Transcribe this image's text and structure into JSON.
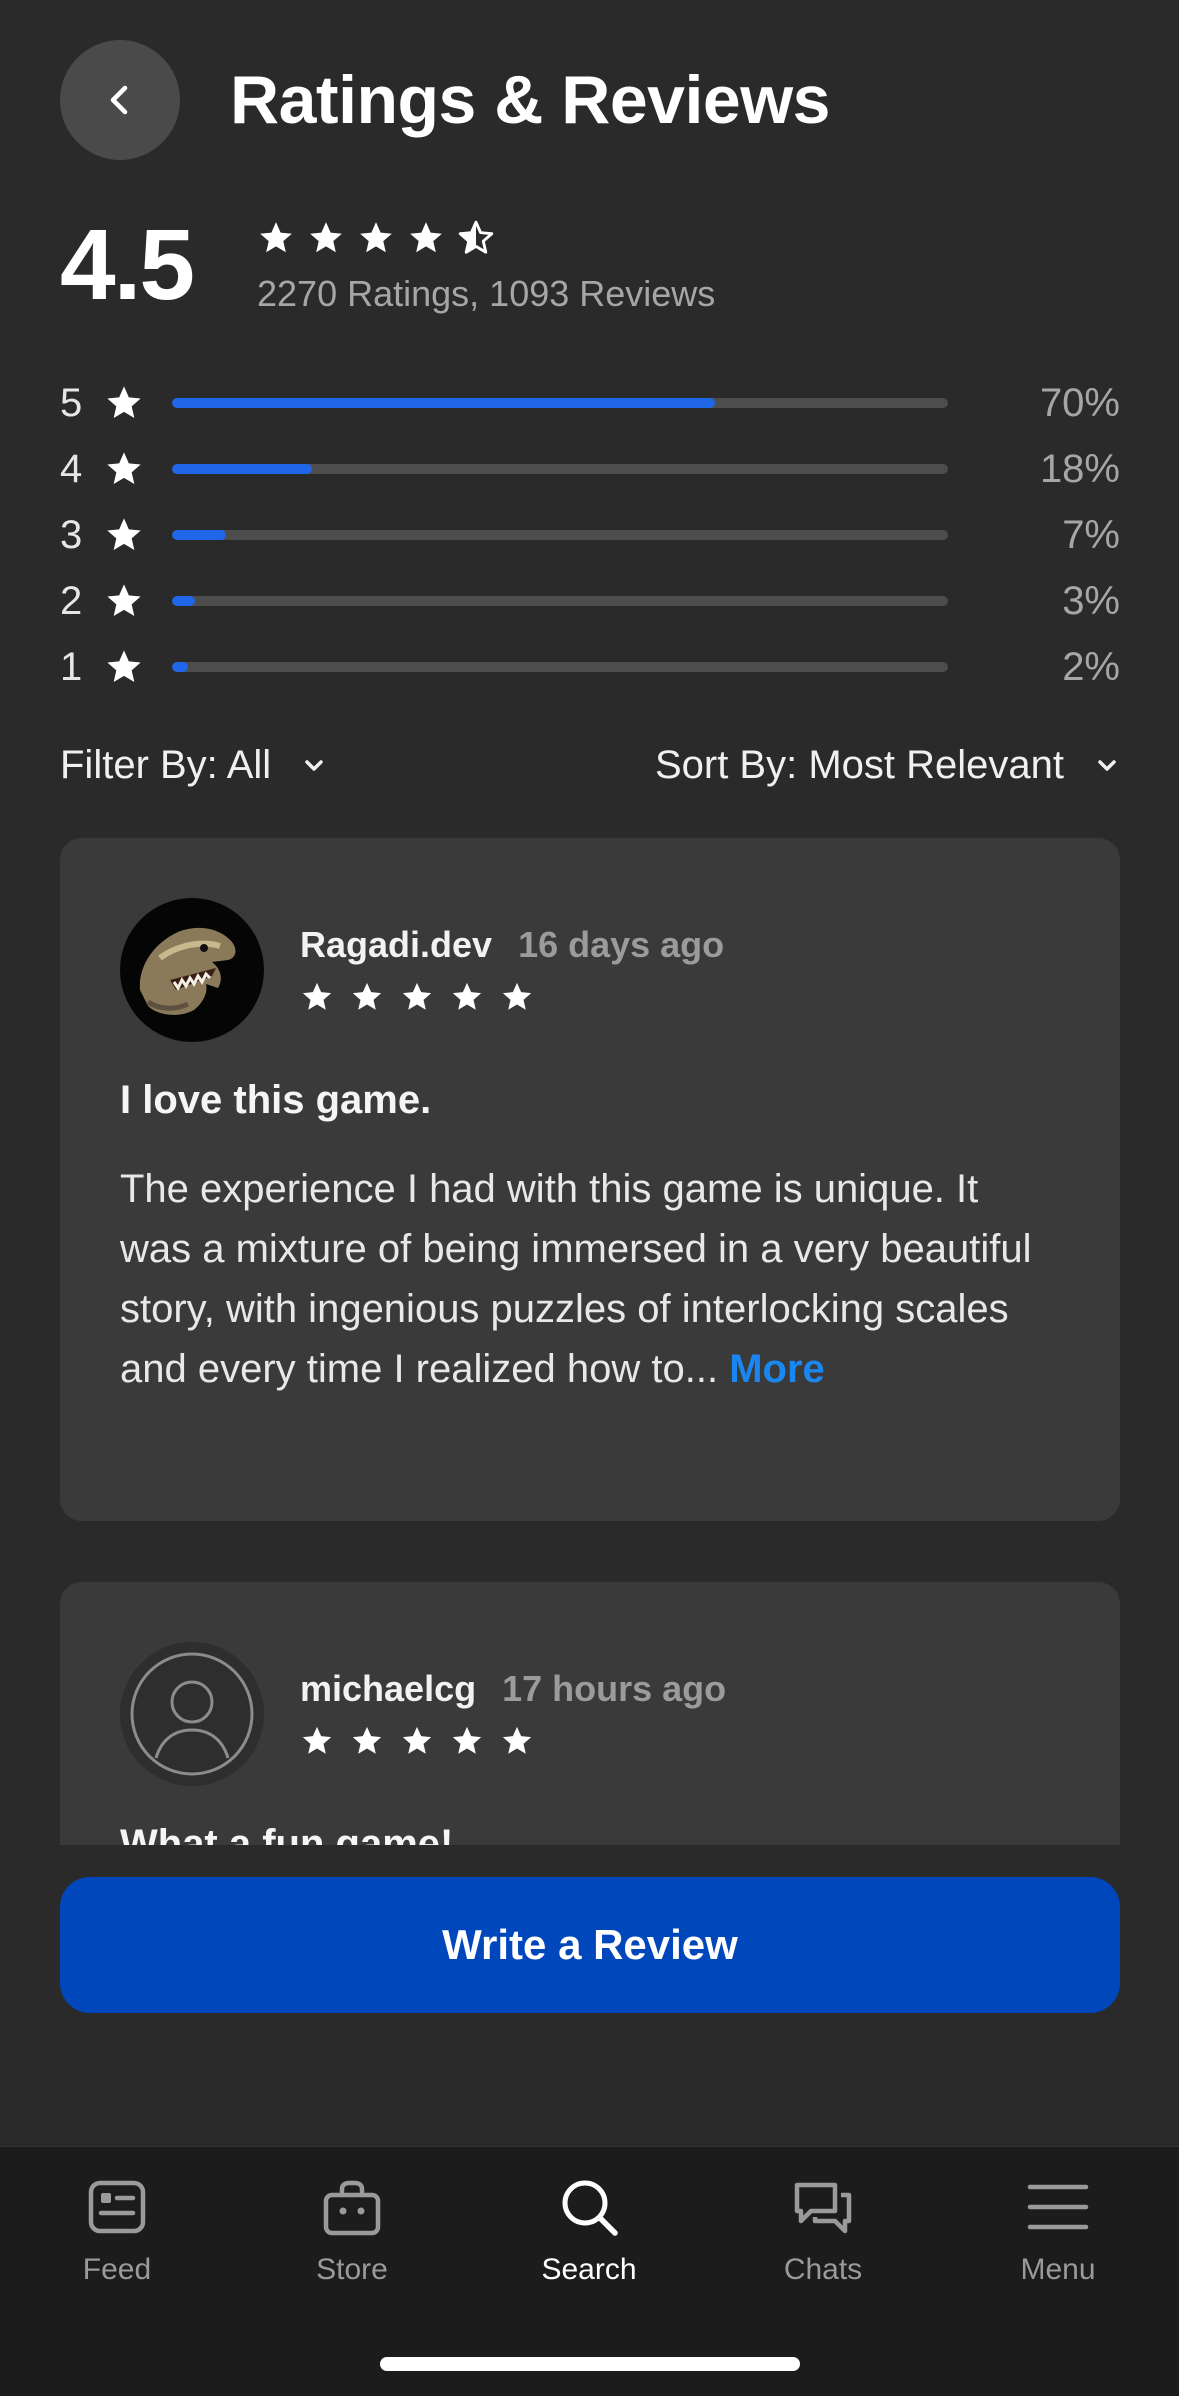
{
  "header": {
    "title": "Ratings & Reviews"
  },
  "summary": {
    "rating": "4.5",
    "rating_value": 4.5,
    "counts": "2270 Ratings, 1093 Reviews"
  },
  "histogram": [
    {
      "stars": "5",
      "percent": "70%",
      "fraction": 0.7
    },
    {
      "stars": "4",
      "percent": "18%",
      "fraction": 0.18
    },
    {
      "stars": "3",
      "percent": "7%",
      "fraction": 0.07
    },
    {
      "stars": "2",
      "percent": "3%",
      "fraction": 0.03
    },
    {
      "stars": "1",
      "percent": "2%",
      "fraction": 0.02
    }
  ],
  "filters": {
    "filter_label": "Filter By: All",
    "sort_label": "Sort By: Most Relevant"
  },
  "reviews": [
    {
      "author": "Ragadi.dev",
      "time": "16 days ago",
      "stars": 5,
      "title": "I love this game.",
      "body": "The experience I had with this game is unique. It was a mixture of being immersed in a very beautiful story, with ingenious puzzles of interlocking scales and every time I realized how to...",
      "more": "More"
    },
    {
      "author": "michaelcg",
      "time": "17 hours ago",
      "stars": 5,
      "title": "What a fun game!"
    }
  ],
  "write_review": "Write a Review",
  "nav": {
    "items": [
      {
        "label": "Feed",
        "icon": "feed-icon"
      },
      {
        "label": "Store",
        "icon": "store-icon"
      },
      {
        "label": "Search",
        "icon": "search-icon",
        "active": true
      },
      {
        "label": "Chats",
        "icon": "chats-icon"
      },
      {
        "label": "Menu",
        "icon": "menu-icon"
      }
    ]
  },
  "colors": {
    "background": "#2a2a2a",
    "card": "#3a3a3a",
    "accent_bar": "#1f66e8",
    "button": "#0047bb",
    "link": "#1a86f0"
  }
}
